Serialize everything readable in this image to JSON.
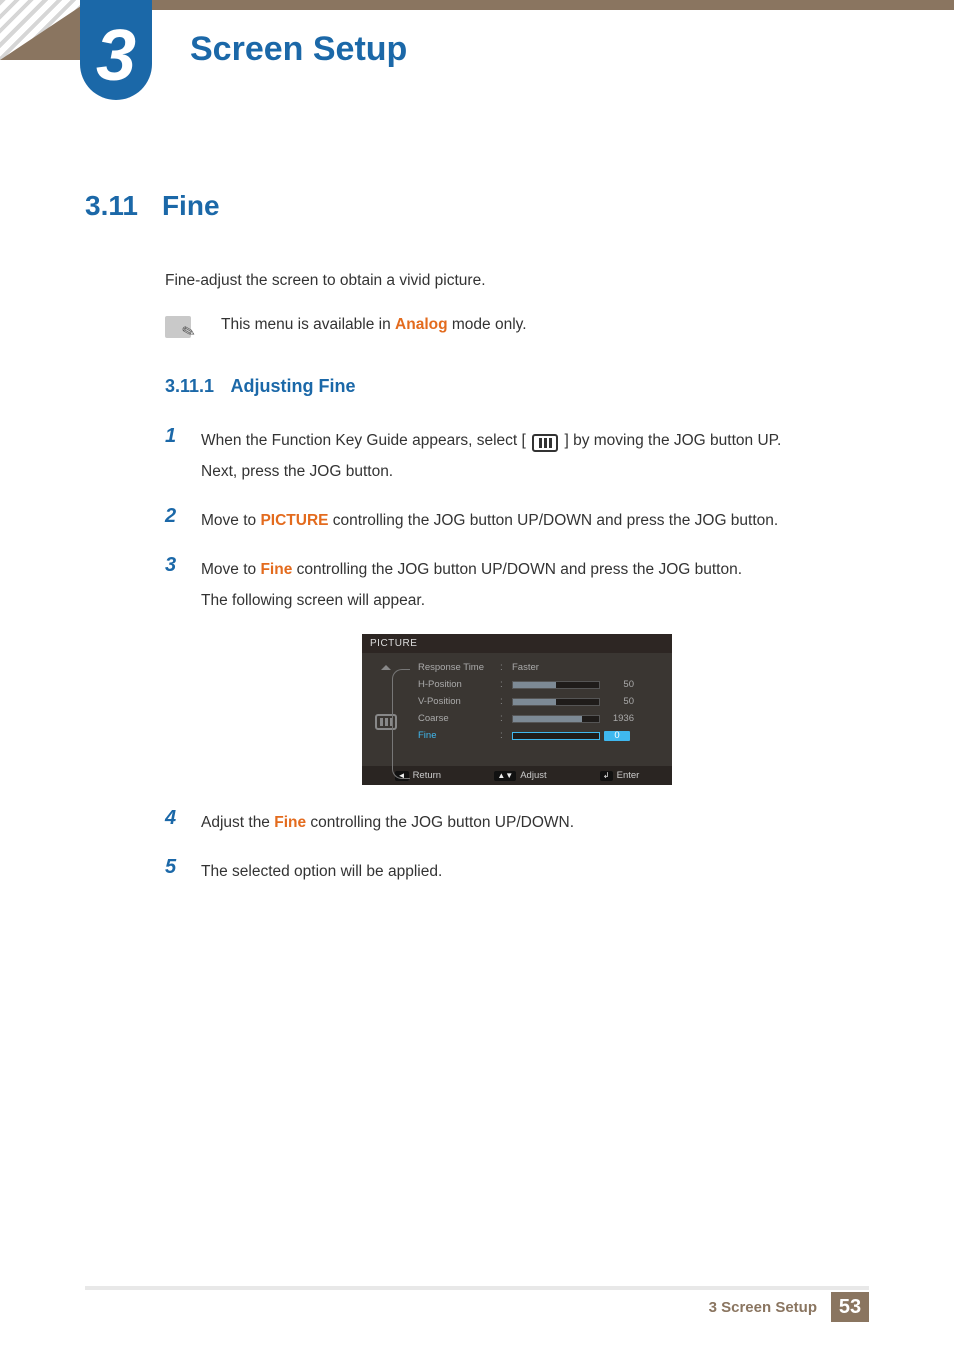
{
  "header": {
    "chapter_number": "3",
    "chapter_title": "Screen Setup"
  },
  "section": {
    "number": "3.11",
    "title": "Fine",
    "intro": "Fine-adjust the screen to obtain a vivid picture.",
    "note_prefix": "This menu is available in ",
    "note_highlight": "Analog",
    "note_suffix": " mode only."
  },
  "subsection": {
    "number": "3.11.1",
    "title": "Adjusting Fine"
  },
  "steps": {
    "s1": {
      "num": "1",
      "line1a": "When the Function Key Guide appears, select ",
      "line1b": " by moving the JOG button UP.",
      "line2": "Next, press the JOG button."
    },
    "s2": {
      "num": "2",
      "a": "Move to ",
      "b": "PICTURE",
      "c": " controlling the JOG button UP/DOWN and press the JOG button."
    },
    "s3": {
      "num": "3",
      "a": "Move to ",
      "b": "Fine",
      "c": " controlling the JOG button UP/DOWN and press the JOG button.",
      "d": "The following screen will appear."
    },
    "s4": {
      "num": "4",
      "a": "Adjust the ",
      "b": "Fine",
      "c": " controlling the JOG button UP/DOWN."
    },
    "s5": {
      "num": "5",
      "text": "The selected option will be applied."
    }
  },
  "osd": {
    "title": "PICTURE",
    "rows": {
      "response_time": {
        "label": "Response Time",
        "value": "Faster"
      },
      "h_position": {
        "label": "H-Position",
        "value": "50",
        "fill": "50%"
      },
      "v_position": {
        "label": "V-Position",
        "value": "50",
        "fill": "50%"
      },
      "coarse": {
        "label": "Coarse",
        "value": "1936",
        "fill": "80%"
      },
      "fine": {
        "label": "Fine",
        "value": "0",
        "fill": "0%"
      }
    },
    "footer": {
      "return_key": "◄",
      "return_label": "Return",
      "adjust_key": "▲▼",
      "adjust_label": "Adjust",
      "enter_key": "↲",
      "enter_label": "Enter"
    }
  },
  "footer": {
    "label": "3 Screen Setup",
    "page": "53"
  }
}
